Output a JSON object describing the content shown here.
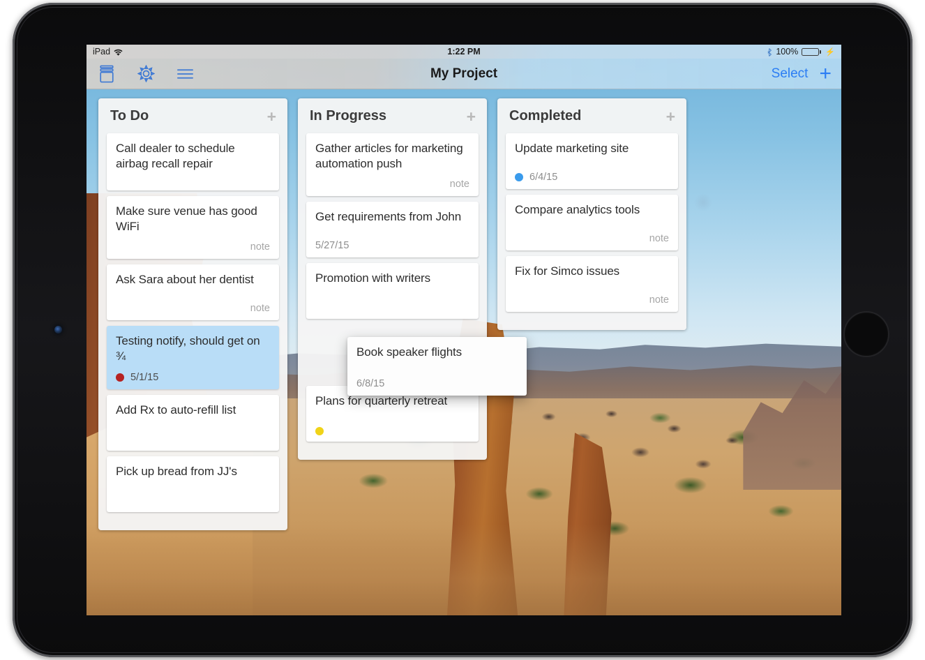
{
  "device": {
    "name": "iPad"
  },
  "status_bar": {
    "carrier": "iPad",
    "wifi_icon": "wifi-icon",
    "time": "1:22 PM",
    "bluetooth_icon": "bluetooth-icon",
    "battery_percent": "100%",
    "battery_level": 100,
    "charging_icon": "lightning-bolt-icon"
  },
  "nav_bar": {
    "title": "My Project",
    "left_buttons": [
      {
        "name": "archive-box-icon",
        "label": "Archive"
      },
      {
        "name": "gear-icon",
        "label": "Settings"
      },
      {
        "name": "hamburger-menu-icon",
        "label": "Menu"
      }
    ],
    "select_label": "Select",
    "add_label": "+",
    "tint_color": "#2b7df4"
  },
  "board": {
    "columns": [
      {
        "title": "To Do",
        "add_label": "+",
        "cards": [
          {
            "title": "Call dealer to schedule airbag recall repair",
            "date": "",
            "note": "",
            "dot": "",
            "selected": false
          },
          {
            "title": "Make sure venue has good WiFi",
            "date": "",
            "note": "note",
            "dot": "",
            "selected": false
          },
          {
            "title": "Ask Sara about her dentist",
            "date": "",
            "note": "note",
            "dot": "",
            "selected": false
          },
          {
            "title": "Testing notify, should get on ¾",
            "date": "5/1/15",
            "note": "",
            "dot": "#b52222",
            "selected": true
          },
          {
            "title": "Add Rx to auto-refill list",
            "date": "",
            "note": "",
            "dot": "",
            "selected": false
          },
          {
            "title": "Pick up bread from JJ's",
            "date": "",
            "note": "",
            "dot": "",
            "selected": false
          }
        ]
      },
      {
        "title": "In Progress",
        "add_label": "+",
        "cards": [
          {
            "title": "Gather articles for marketing automation push",
            "date": "",
            "note": "note",
            "dot": "",
            "selected": false
          },
          {
            "title": "Get requirements from John",
            "date": "5/27/15",
            "note": "",
            "dot": "",
            "selected": false
          },
          {
            "title": "Promotion with writers",
            "date": "",
            "note": "",
            "dot": "",
            "selected": false
          },
          {
            "title": "",
            "date": "",
            "note": "",
            "dot": "",
            "selected": false,
            "ghost": true
          },
          {
            "title": "Plans for quarterly retreat",
            "date": "",
            "note": "",
            "dot": "#f0d318",
            "selected": false
          }
        ]
      },
      {
        "title": "Completed",
        "add_label": "+",
        "cards": [
          {
            "title": "Update marketing site",
            "date": "6/4/15",
            "note": "",
            "dot": "#3a9bec",
            "selected": false
          },
          {
            "title": "Compare analytics tools",
            "date": "",
            "note": "note",
            "dot": "",
            "selected": false
          },
          {
            "title": "Fix for Simco issues",
            "date": "",
            "note": "note",
            "dot": "",
            "selected": false
          }
        ]
      }
    ]
  },
  "dragged_card": {
    "title": "Book speaker flights",
    "date": "6/8/15",
    "note": "",
    "dot": ""
  }
}
